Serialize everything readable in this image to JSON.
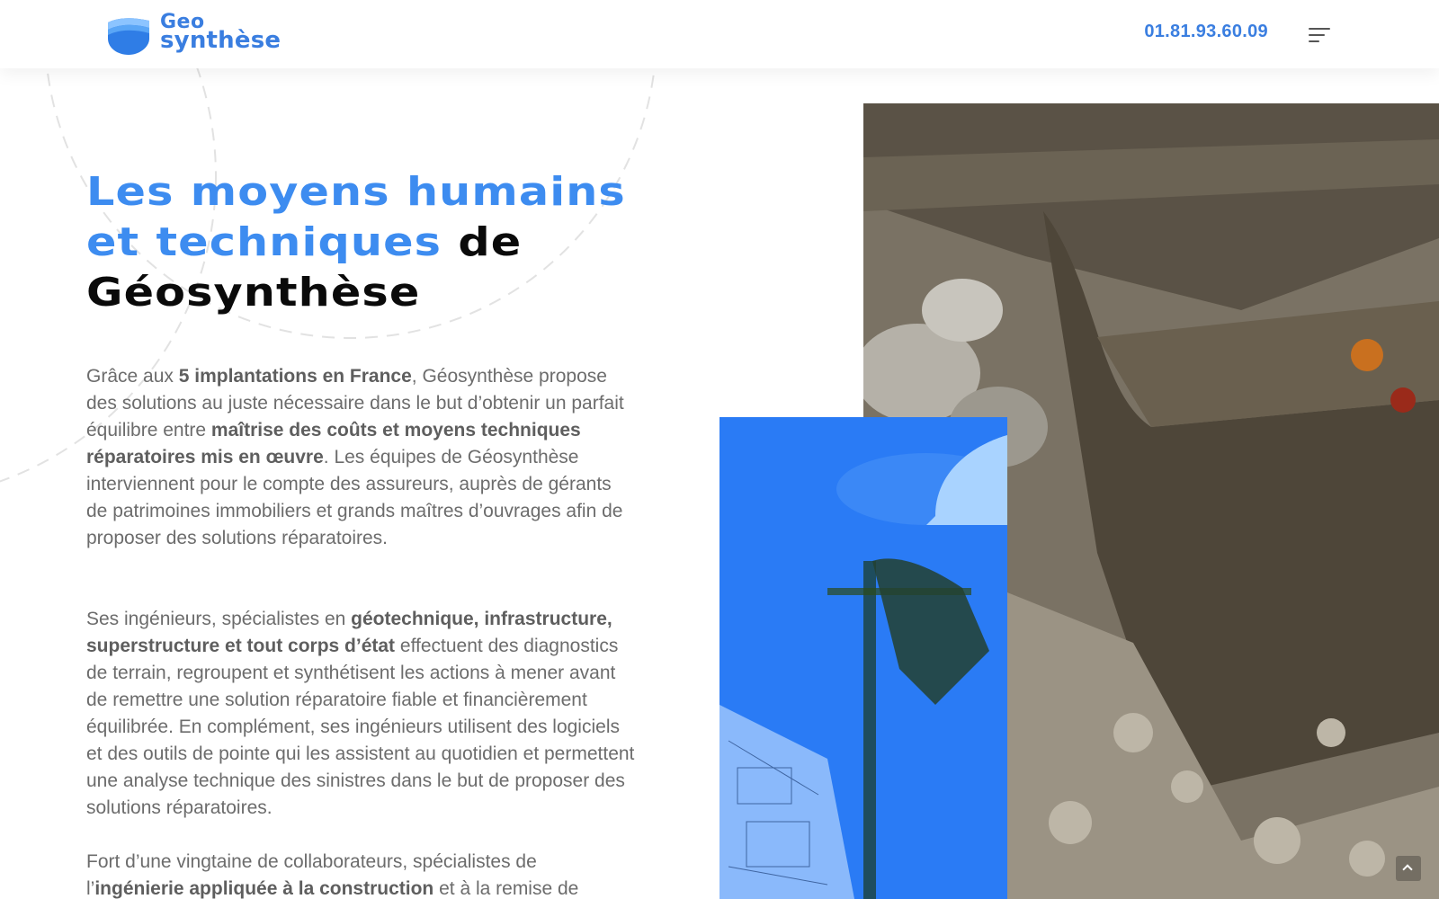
{
  "header": {
    "logo": {
      "line1": "Geo",
      "line2": "synthèse"
    },
    "phone": "01.81.93.60.09",
    "menu_icon": "hamburger-menu-icon"
  },
  "intro": {
    "title_blue": "Les moyens humains et techniques",
    "title_dark_1": "de",
    "title_dark_2": "Géosynthèse"
  },
  "paragraphs": {
    "p1": {
      "t1": "Grâce aux ",
      "b1": "5 implantations en France",
      "t2": ", Géosynthèse propose des solutions au juste nécessaire dans le but d’obtenir un parfait équilibre entre ",
      "b2": "maîtrise des coûts et moyens techniques réparatoires mis en œuvre",
      "t3": ". Les équipes de Géosynthèse interviennent pour le compte des assureurs, auprès de gérants de patrimoines immobiliers et grands maîtres d’ouvrages afin de proposer des solutions réparatoires."
    },
    "p2": {
      "t1": "Ses ingénieurs, spécialistes en ",
      "b1": "géotechnique, infrastructure, superstructure et tout corps d’état",
      "t2": " effectuent des diagnostics de terrain, regroupent et synthétisent les actions à mener avant de remettre une solution réparatoire fiable et financièrement équilibrée. En complément, ses ingénieurs utilisent des logiciels et des outils de pointe qui les assistent au quotidien et permettent une analyse technique des sinistres dans le but de proposer des solutions réparatoires."
    },
    "p3": {
      "t1": "Fort d’une vingtaine de collaborateurs, spécialistes de l’",
      "b1": "ingénierie appliquée à la construction",
      "t2": " et à la remise de"
    }
  },
  "colors": {
    "brand_blue": "#3d8cf0",
    "text_gray": "#6c6c6c",
    "title_dark": "#0a0a0a"
  }
}
